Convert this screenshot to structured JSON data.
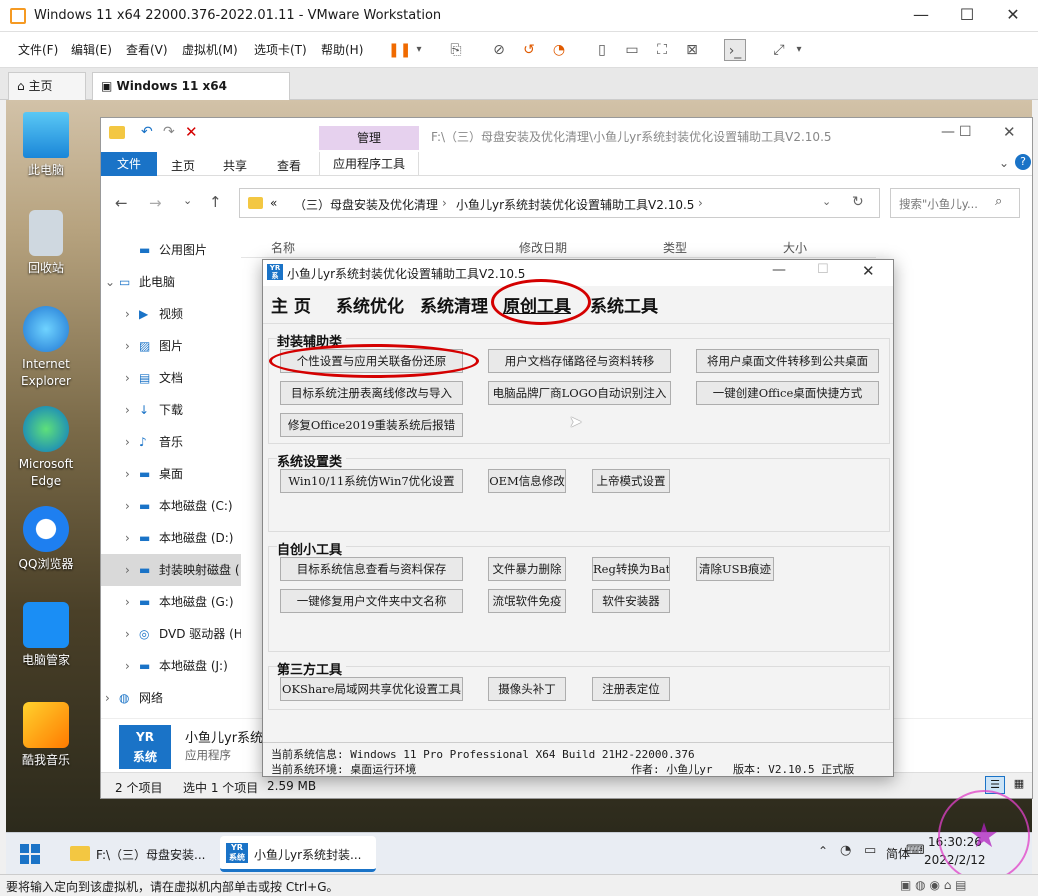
{
  "vm": {
    "title": "Windows 11 x64 22000.376-2022.01.11 - VMware Workstation",
    "menu": [
      "文件(F)",
      "编辑(E)",
      "查看(V)",
      "虚拟机(M)",
      "选项卡(T)",
      "帮助(H)"
    ],
    "tabs": {
      "home": "主页",
      "active": "Windows 11 x64 22000.37..."
    },
    "status": "要将输入定向到该虚拟机，请在虚拟机内部单击或按 Ctrl+G。"
  },
  "desktop": {
    "icons": [
      "此电脑",
      "回收站",
      "Internet Explorer",
      "Microsoft Edge",
      "QQ浏览器",
      "电脑管家",
      "酷我音乐"
    ]
  },
  "explorer": {
    "title": "F:\\（三）母盘安装及优化清理\\小鱼儿yr系统封装优化设置辅助工具V2.10.5",
    "ribbon_context": "管理",
    "ribbon_tabs": [
      "文件",
      "主页",
      "共享",
      "查看",
      "应用程序工具"
    ],
    "address": [
      "«",
      "（三）母盘安装及优化清理",
      "›",
      "小鱼儿yr系统封装优化设置辅助工具V2.10.5",
      "›"
    ],
    "search_placeholder": "搜索\"小鱼儿y...",
    "columns": [
      "名称",
      "修改日期",
      "类型",
      "大小"
    ],
    "nav": [
      "公用图片",
      "此电脑",
      "视频",
      "图片",
      "文档",
      "下载",
      "音乐",
      "桌面",
      "本地磁盘 (C:)",
      "本地磁盘 (D:)",
      "封装映射磁盘 (",
      "本地磁盘 (G:)",
      "DVD 驱动器 (H",
      "本地磁盘 (J:)",
      "网络"
    ],
    "detail_name": "小鱼儿yr系统...",
    "detail_type": "应用程序",
    "status": {
      "items": "2 个项目",
      "selected": "选中 1 个项目",
      "size": "2.59 MB"
    }
  },
  "tool": {
    "title": "小鱼儿yr系统封装优化设置辅助工具V2.10.5",
    "tabs": [
      "主 页",
      "系统优化",
      "系统清理",
      "原创工具",
      "系统工具"
    ],
    "groups": [
      {
        "label": "封装辅助类",
        "buttons": [
          "个性设置与应用关联备份还原",
          "用户文档存储路径与资料转移",
          "将用户桌面文件转移到公共桌面",
          "目标系统注册表离线修改与导入",
          "电脑品牌厂商LOGO自动识别注入",
          "一键创建Office桌面快捷方式",
          "修复Office2019重装系统后报错"
        ]
      },
      {
        "label": "系统设置类",
        "buttons": [
          "Win10/11系统仿Win7优化设置",
          "OEM信息修改",
          "上帝模式设置"
        ]
      },
      {
        "label": "自创小工具",
        "buttons": [
          "目标系统信息查看与资料保存",
          "文件暴力删除",
          "Reg转换为Bat",
          "清除USB痕迹",
          "一键修复用户文件夹中文名称",
          "流氓软件免疫",
          "软件安装器"
        ]
      },
      {
        "label": "第三方工具",
        "buttons": [
          "OKShare局域网共享优化设置工具",
          "摄像头补丁",
          "注册表定位"
        ]
      }
    ],
    "footer_line1": "当前系统信息: Windows 11 Pro Professional X64 Build 21H2-22000.376",
    "footer_line2": "当前系统环境: 桌面运行环境",
    "footer_author": "作者: 小鱼儿yr",
    "footer_version": "版本: V2.10.5 正式版"
  },
  "taskbar": {
    "items": [
      "F:\\（三）母盘安装...",
      "小鱼儿yr系统封装..."
    ],
    "ime": "简体",
    "time": "16:30:26",
    "date": "2022/2/12"
  },
  "colors": {
    "accent": "#1a73c7",
    "highlight": "#d40000",
    "ribbon_context": "#e6d1ee"
  }
}
